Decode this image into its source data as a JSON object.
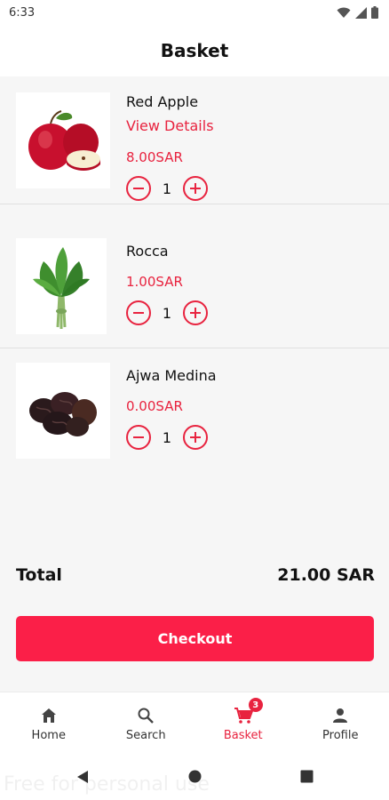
{
  "status_bar": {
    "time": "6:33"
  },
  "header": {
    "title": "Basket"
  },
  "items": [
    {
      "name": "Red Apple",
      "link": "View Details",
      "price": "8.00SAR",
      "qty": "1"
    },
    {
      "name": "Rocca",
      "price": "1.00SAR",
      "qty": "1"
    },
    {
      "name": "Ajwa Medina",
      "price": "0.00SAR",
      "qty": "1"
    }
  ],
  "summary": {
    "total_label": "Total",
    "total_value": "21.00 SAR"
  },
  "checkout": {
    "label": "Checkout"
  },
  "nav": [
    {
      "label": "Home",
      "icon": "home-icon"
    },
    {
      "label": "Search",
      "icon": "search-icon"
    },
    {
      "label": "Basket",
      "icon": "cart-icon",
      "badge": "3",
      "active": true
    },
    {
      "label": "Profile",
      "icon": "person-icon"
    }
  ],
  "watermark": "Free for personal use",
  "colors": {
    "accent": "#e8233f",
    "button": "#fb1f48"
  }
}
